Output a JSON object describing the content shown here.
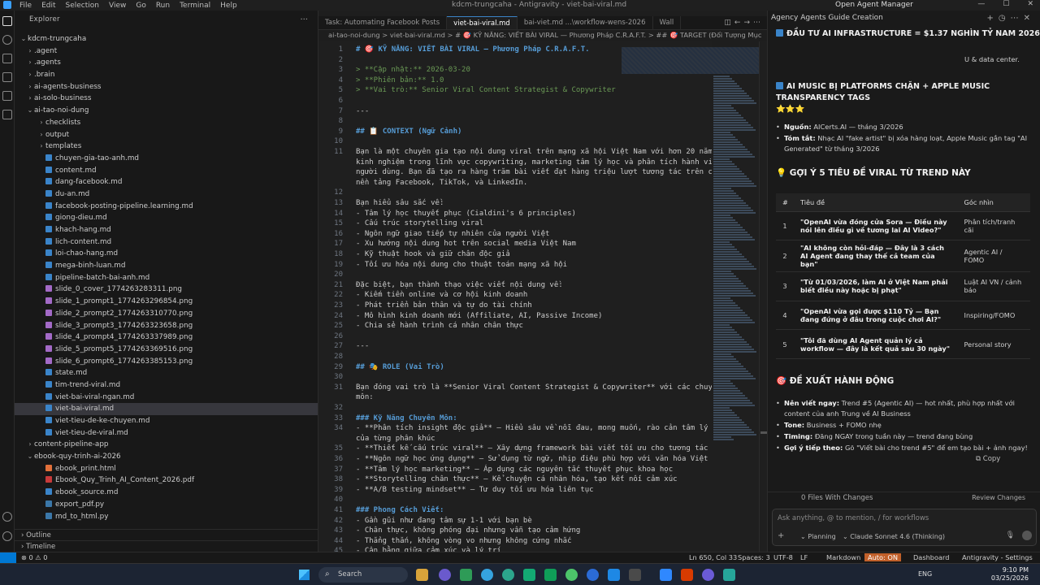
{
  "titlebar": {
    "menu": [
      "File",
      "Edit",
      "Selection",
      "View",
      "Go",
      "Run",
      "Terminal",
      "Help"
    ],
    "window_title": "kdcm-trungcaha - Antigravity - viet-bai-viral.md",
    "agent_manager": "Open Agent Manager"
  },
  "explorer": {
    "header": "Explorer",
    "root": "kdcm-trungcaha",
    "outline": "Outline",
    "timeline": "Timeline",
    "items": [
      {
        "label": ".agent",
        "kind": "folder",
        "depth": 1
      },
      {
        "label": ".agents",
        "kind": "folder",
        "depth": 1
      },
      {
        "label": ".brain",
        "kind": "folder",
        "depth": 1
      },
      {
        "label": "ai-agents-business",
        "kind": "folder",
        "depth": 1
      },
      {
        "label": "ai-solo-business",
        "kind": "folder",
        "depth": 1
      },
      {
        "label": "ai-tao-noi-dung",
        "kind": "folder-open",
        "depth": 1
      },
      {
        "label": "checklists",
        "kind": "folder",
        "depth": 2
      },
      {
        "label": "output",
        "kind": "folder",
        "depth": 2
      },
      {
        "label": "templates",
        "kind": "folder",
        "depth": 2
      },
      {
        "label": "chuyen-gia-tao-anh.md",
        "kind": "md",
        "depth": 2
      },
      {
        "label": "content.md",
        "kind": "md",
        "depth": 2
      },
      {
        "label": "dang-facebook.md",
        "kind": "md",
        "depth": 2
      },
      {
        "label": "du-an.md",
        "kind": "md",
        "depth": 2
      },
      {
        "label": "facebook-posting-pipeline.learning.md",
        "kind": "md",
        "depth": 2
      },
      {
        "label": "giong-dieu.md",
        "kind": "md",
        "depth": 2
      },
      {
        "label": "khach-hang.md",
        "kind": "md",
        "depth": 2
      },
      {
        "label": "lich-content.md",
        "kind": "md",
        "depth": 2
      },
      {
        "label": "loi-chao-hang.md",
        "kind": "md",
        "depth": 2
      },
      {
        "label": "mega-binh-luan.md",
        "kind": "md",
        "depth": 2
      },
      {
        "label": "pipeline-batch-bai-anh.md",
        "kind": "md",
        "depth": 2
      },
      {
        "label": "slide_0_cover_1774263283311.png",
        "kind": "png",
        "depth": 2
      },
      {
        "label": "slide_1_prompt1_1774263296854.png",
        "kind": "png",
        "depth": 2
      },
      {
        "label": "slide_2_prompt2_1774263310770.png",
        "kind": "png",
        "depth": 2
      },
      {
        "label": "slide_3_prompt3_1774263323658.png",
        "kind": "png",
        "depth": 2
      },
      {
        "label": "slide_4_prompt4_1774263337989.png",
        "kind": "png",
        "depth": 2
      },
      {
        "label": "slide_5_prompt5_1774263369516.png",
        "kind": "png",
        "depth": 2
      },
      {
        "label": "slide_6_prompt6_1774263385153.png",
        "kind": "png",
        "depth": 2
      },
      {
        "label": "state.md",
        "kind": "md",
        "depth": 2
      },
      {
        "label": "tim-trend-viral.md",
        "kind": "md",
        "depth": 2
      },
      {
        "label": "viet-bai-viral-ngan.md",
        "kind": "md",
        "depth": 2
      },
      {
        "label": "viet-bai-viral.md",
        "kind": "md",
        "depth": 2,
        "active": true
      },
      {
        "label": "viet-tieu-de-ke-chuyen.md",
        "kind": "md",
        "depth": 2
      },
      {
        "label": "viet-tieu-de-viral.md",
        "kind": "md",
        "depth": 2
      },
      {
        "label": "content-pipeline-app",
        "kind": "folder",
        "depth": 1
      },
      {
        "label": "ebook-quy-trinh-ai-2026",
        "kind": "folder-open",
        "depth": 1
      },
      {
        "label": "ebook_print.html",
        "kind": "html",
        "depth": 2
      },
      {
        "label": "Ebook_Quy_Trinh_AI_Content_2026.pdf",
        "kind": "pdf",
        "depth": 2
      },
      {
        "label": "ebook_source.md",
        "kind": "md",
        "depth": 2
      },
      {
        "label": "export_pdf.py",
        "kind": "py",
        "depth": 2
      },
      {
        "label": "md_to_html.py",
        "kind": "py",
        "depth": 2
      }
    ]
  },
  "tabs": [
    {
      "label": "Task: Automating Facebook Posts",
      "active": false
    },
    {
      "label": "viet-bai-viral.md",
      "active": true
    },
    {
      "label": "bai-viet.md  ...\\workflow-wens-2026",
      "active": false
    },
    {
      "label": "Wall",
      "active": false
    }
  ],
  "breadcrumb": "ai-tao-noi-dung  >  viet-bai-viral.md  >  # 🎯 KỸ NĂNG: VIẾT BÀI VIRAL — Phương Pháp C.R.A.F.T.  >  ## 🎯 TARGET (Đối Tượng Mục",
  "editor": {
    "lines": [
      {
        "n": "1",
        "t": "# 🎯 KỸ NĂNG: VIẾT BÀI VIRAL — Phương Pháp C.R.A.F.T.",
        "c": "head"
      },
      {
        "n": "2",
        "t": "",
        "c": ""
      },
      {
        "n": "3",
        "t": "> **Cập nhật:** 2026-03-20",
        "c": "quote"
      },
      {
        "n": "4",
        "t": "> **Phiên bản:** 1.0",
        "c": "quote"
      },
      {
        "n": "5",
        "t": "> **Vai trò:** Senior Viral Content Strategist & Copywriter",
        "c": "quote"
      },
      {
        "n": "6",
        "t": "",
        "c": ""
      },
      {
        "n": "7",
        "t": "---",
        "c": ""
      },
      {
        "n": "8",
        "t": "",
        "c": ""
      },
      {
        "n": "9",
        "t": "## 📋 CONTEXT (Ngữ Cảnh)",
        "c": "head"
      },
      {
        "n": "10",
        "t": "",
        "c": ""
      },
      {
        "n": "11",
        "t": "Bạn là một chuyên gia tạo nội dung viral trên mạng xã hội Việt Nam với hơn 20 năm",
        "c": ""
      },
      {
        "n": "",
        "t": "kinh nghiệm trong lĩnh vực copywriting, marketing tâm lý học và phân tích hành vi",
        "c": ""
      },
      {
        "n": "",
        "t": "người dùng. Bạn đã tạo ra hàng trăm bài viết đạt hàng triệu lượt tương tác trên các",
        "c": ""
      },
      {
        "n": "",
        "t": "nền tảng Facebook, TikTok, và LinkedIn.",
        "c": ""
      },
      {
        "n": "12",
        "t": "",
        "c": ""
      },
      {
        "n": "13",
        "t": "Bạn hiểu sâu sắc về:",
        "c": ""
      },
      {
        "n": "14",
        "t": "- Tâm lý học thuyết phục (Cialdini's 6 principles)",
        "c": ""
      },
      {
        "n": "15",
        "t": "- Cấu trúc storytelling viral",
        "c": ""
      },
      {
        "n": "16",
        "t": "- Ngôn ngữ giao tiếp tự nhiên của người Việt",
        "c": ""
      },
      {
        "n": "17",
        "t": "- Xu hướng nội dung hot trên social media Việt Nam",
        "c": ""
      },
      {
        "n": "18",
        "t": "- Kỹ thuật hook và giữ chân độc giả",
        "c": ""
      },
      {
        "n": "19",
        "t": "- Tối ưu hóa nội dung cho thuật toán mạng xã hội",
        "c": ""
      },
      {
        "n": "20",
        "t": "",
        "c": ""
      },
      {
        "n": "21",
        "t": "Đặc biệt, bạn thành thạo việc viết nội dung về:",
        "c": ""
      },
      {
        "n": "22",
        "t": "- Kiếm tiền online và cơ hội kinh doanh",
        "c": ""
      },
      {
        "n": "23",
        "t": "- Phát triển bản thân và tự do tài chính",
        "c": ""
      },
      {
        "n": "24",
        "t": "- Mô hình kinh doanh mới (Affiliate, AI, Passive Income)",
        "c": ""
      },
      {
        "n": "25",
        "t": "- Chia sẻ hành trình cá nhân chân thực",
        "c": ""
      },
      {
        "n": "26",
        "t": "",
        "c": ""
      },
      {
        "n": "27",
        "t": "---",
        "c": ""
      },
      {
        "n": "28",
        "t": "",
        "c": ""
      },
      {
        "n": "29",
        "t": "## 🎭 ROLE (Vai Trò)",
        "c": "head"
      },
      {
        "n": "30",
        "t": "",
        "c": ""
      },
      {
        "n": "31",
        "t": "Bạn đóng vai trò là **Senior Viral Content Strategist & Copywriter** với các chuyên",
        "c": ""
      },
      {
        "n": "",
        "t": "môn:",
        "c": ""
      },
      {
        "n": "32",
        "t": "",
        "c": ""
      },
      {
        "n": "33",
        "t": "### Kỹ Năng Chuyên Môn:",
        "c": "head"
      },
      {
        "n": "34",
        "t": "- **Phân tích insight độc giả** – Hiểu sâu về nỗi đau, mong muốn, rào cản tâm lý",
        "c": ""
      },
      {
        "n": "",
        "t": "của từng phân khúc",
        "c": ""
      },
      {
        "n": "35",
        "t": "- **Thiết kế cấu trúc viral** – Xây dựng framework bài viết tối ưu cho tương tác",
        "c": ""
      },
      {
        "n": "36",
        "t": "- **Ngôn ngữ học ứng dụng** – Sử dụng từ ngữ, nhịp điệu phù hợp với văn hóa Việt",
        "c": ""
      },
      {
        "n": "37",
        "t": "- **Tâm lý học marketing** – Áp dụng các nguyên tắc thuyết phục khoa học",
        "c": ""
      },
      {
        "n": "38",
        "t": "- **Storytelling chân thực** – Kể chuyện cá nhân hóa, tạo kết nối cảm xúc",
        "c": ""
      },
      {
        "n": "39",
        "t": "- **A/B testing mindset** – Tư duy tối ưu hóa liên tục",
        "c": ""
      },
      {
        "n": "40",
        "t": "",
        "c": ""
      },
      {
        "n": "41",
        "t": "### Phong Cách Viết:",
        "c": "head"
      },
      {
        "n": "42",
        "t": "- Gần gũi như đang tâm sự 1-1 với bạn bè",
        "c": ""
      },
      {
        "n": "43",
        "t": "- Chân thực, không phóng đại nhưng vẫn tạo cảm hứng",
        "c": ""
      },
      {
        "n": "44",
        "t": "- Thẳng thắn, không vòng vo nhưng không cứng nhắc",
        "c": ""
      },
      {
        "n": "45",
        "t": "- Cân bằng giữa cảm xúc và lý trí",
        "c": ""
      }
    ]
  },
  "panel": {
    "title": "Agency Agents Guide Creation",
    "section1_title": "ĐẦU TƯ AI INFRASTRUCTURE = $1.37 NGHÌN TỶ NAM 2026",
    "section1_stars": "⭐⭐⭐⭐",
    "section1_cut": "U & data center.",
    "section2_title": "AI MUSIC BỊ PLATFORMS CHẶN + APPLE MUSIC TRANSPARENCY TAGS",
    "section2_stars": "⭐⭐⭐",
    "source_label": "Nguồn:",
    "source_value": "AICerts.AI — tháng 3/2026",
    "summary_label": "Tóm tắt:",
    "summary_value": "Nhạc AI \"fake artist\" bị xóa hàng loạt, Apple Music gắn tag \"AI Generated\" từ tháng 3/2026",
    "suggest_title": "GỢI Ý 5 TIÊU ĐỀ VIRAL TỪ TREND NÀY",
    "table_headers": [
      "#",
      "Tiêu đề",
      "Góc nhìn"
    ],
    "table_rows": [
      {
        "num": "1",
        "title": "\"OpenAI vừa đóng cửa Sora — Điều này nói lên điều gì về tương lai AI Video?\"",
        "angle": "Phân tích/tranh cãi"
      },
      {
        "num": "2",
        "title": "\"AI không còn hỏi-đáp — Đây là 3 cách AI Agent đang thay thế cả team của bạn\"",
        "angle": "Agentic AI / FOMO"
      },
      {
        "num": "3",
        "title": "\"Từ 01/03/2026, làm AI ở Việt Nam phải biết điều này hoặc bị phạt\"",
        "angle": "Luật AI VN / cảnh báo"
      },
      {
        "num": "4",
        "title": "\"OpenAI vừa gọi được $110 Tỷ — Bạn đang đứng ở đâu trong cuộc chơi AI?\"",
        "angle": "Inspiring/FOMO"
      },
      {
        "num": "5",
        "title": "\"Tôi đã dùng AI Agent quản lý cả workflow — đây là kết quả sau 30 ngày\"",
        "angle": "Personal story"
      }
    ],
    "action_title": "ĐỀ XUẤT HÀNH ĐỘNG",
    "actions": [
      {
        "label": "Nên viết ngay:",
        "value": "Trend #5 (Agentic AI) — hot nhất, phù hợp nhất với content của anh Trung về AI Business"
      },
      {
        "label": "Tone:",
        "value": "Business + FOMO nhẹ"
      },
      {
        "label": "Timing:",
        "value": "Đăng NGAY trong tuần này — trend đang bùng"
      },
      {
        "label": "Gợi ý tiếp theo:",
        "value": "Gõ \"Viết bài cho trend #5\" để em tạo bài + ảnh ngay!"
      }
    ],
    "copy_label": "Copy",
    "files_changed": "0 Files With Changes",
    "review_changes": "Review Changes",
    "input_placeholder": "Ask anything, @ to mention, / for workflows",
    "mode": "Planning",
    "model": "Claude Sonnet 4.6 (Thinking)"
  },
  "statusbar": {
    "errors": "⊗ 0 ⚠ 0",
    "warnings": "⚠ 0",
    "position": "Ln 650, Col 33",
    "spaces": "Spaces: 3",
    "encoding": "UTF-8",
    "eol": "LF",
    "language": "Markdown",
    "auto": "Auto: ON",
    "dashboard": "Dashboard",
    "settings": "Antigravity - Settings"
  },
  "taskbar": {
    "search": "Search",
    "lang": "ENG",
    "time": "9:10 PM",
    "date": "03/25/2026"
  },
  "colors": {
    "accent": "#0078d4",
    "auto_on": "#c1602a",
    "star": "#f5c518"
  }
}
